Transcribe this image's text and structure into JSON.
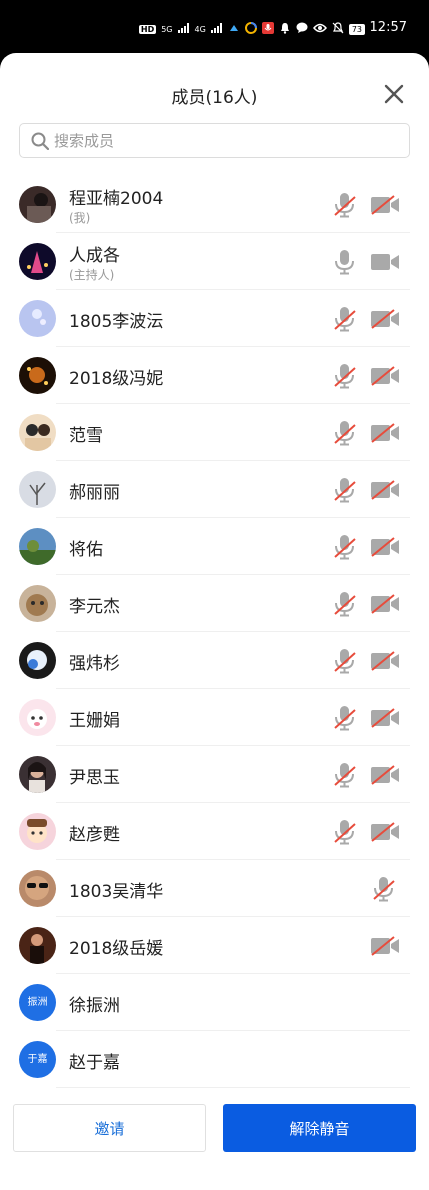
{
  "status_bar": {
    "network_1": "HD",
    "network_2": "5G",
    "network_3": "4G",
    "battery": "73",
    "time": "12:57"
  },
  "panel": {
    "title": "成员(16人)",
    "close_icon": "close-icon"
  },
  "search": {
    "placeholder": "搜索成员",
    "icon": "search-icon"
  },
  "colors": {
    "accent": "#0a5ce1",
    "muted_red": "#e74c3c",
    "icon_gray": "#a9a9a9"
  },
  "members": [
    {
      "name": "程亚楠2004",
      "sub": "(我)",
      "avatar": "photo",
      "mic": "muted",
      "camera": "off"
    },
    {
      "name": "人成各",
      "sub": "(主持人)",
      "avatar": "photo",
      "mic": "on",
      "camera": "on"
    },
    {
      "name": "1805李波沄",
      "sub": "",
      "avatar": "photo",
      "mic": "muted",
      "camera": "off"
    },
    {
      "name": "2018级冯妮",
      "sub": "",
      "avatar": "photo",
      "mic": "muted",
      "camera": "off"
    },
    {
      "name": "范雪",
      "sub": "",
      "avatar": "photo",
      "mic": "muted",
      "camera": "off"
    },
    {
      "name": "郝丽丽",
      "sub": "",
      "avatar": "photo",
      "mic": "muted",
      "camera": "off"
    },
    {
      "name": "将佑",
      "sub": "",
      "avatar": "photo",
      "mic": "muted",
      "camera": "off"
    },
    {
      "name": "李元杰",
      "sub": "",
      "avatar": "photo",
      "mic": "muted",
      "camera": "off"
    },
    {
      "name": "强炜杉",
      "sub": "",
      "avatar": "photo",
      "mic": "muted",
      "camera": "off"
    },
    {
      "name": "王姗娟",
      "sub": "",
      "avatar": "photo",
      "mic": "muted",
      "camera": "off"
    },
    {
      "name": "尹思玉",
      "sub": "",
      "avatar": "photo",
      "mic": "muted",
      "camera": "off"
    },
    {
      "name": "赵彦甦",
      "sub": "",
      "avatar": "photo",
      "mic": "muted",
      "camera": "off"
    },
    {
      "name": "1803吴清华",
      "sub": "",
      "avatar": "photo",
      "mic": "muted",
      "camera": "none"
    },
    {
      "name": "2018级岳媛",
      "sub": "",
      "avatar": "photo",
      "mic": "none",
      "camera": "off"
    },
    {
      "name": "徐振洲",
      "sub": "",
      "avatar": "text",
      "avatar_text": "振洲",
      "mic": "none",
      "camera": "none"
    },
    {
      "name": "赵于嘉",
      "sub": "",
      "avatar": "text",
      "avatar_text": "于嘉",
      "mic": "none",
      "camera": "none"
    }
  ],
  "footer": {
    "invite_label": "邀请",
    "unmute_label": "解除静音"
  }
}
